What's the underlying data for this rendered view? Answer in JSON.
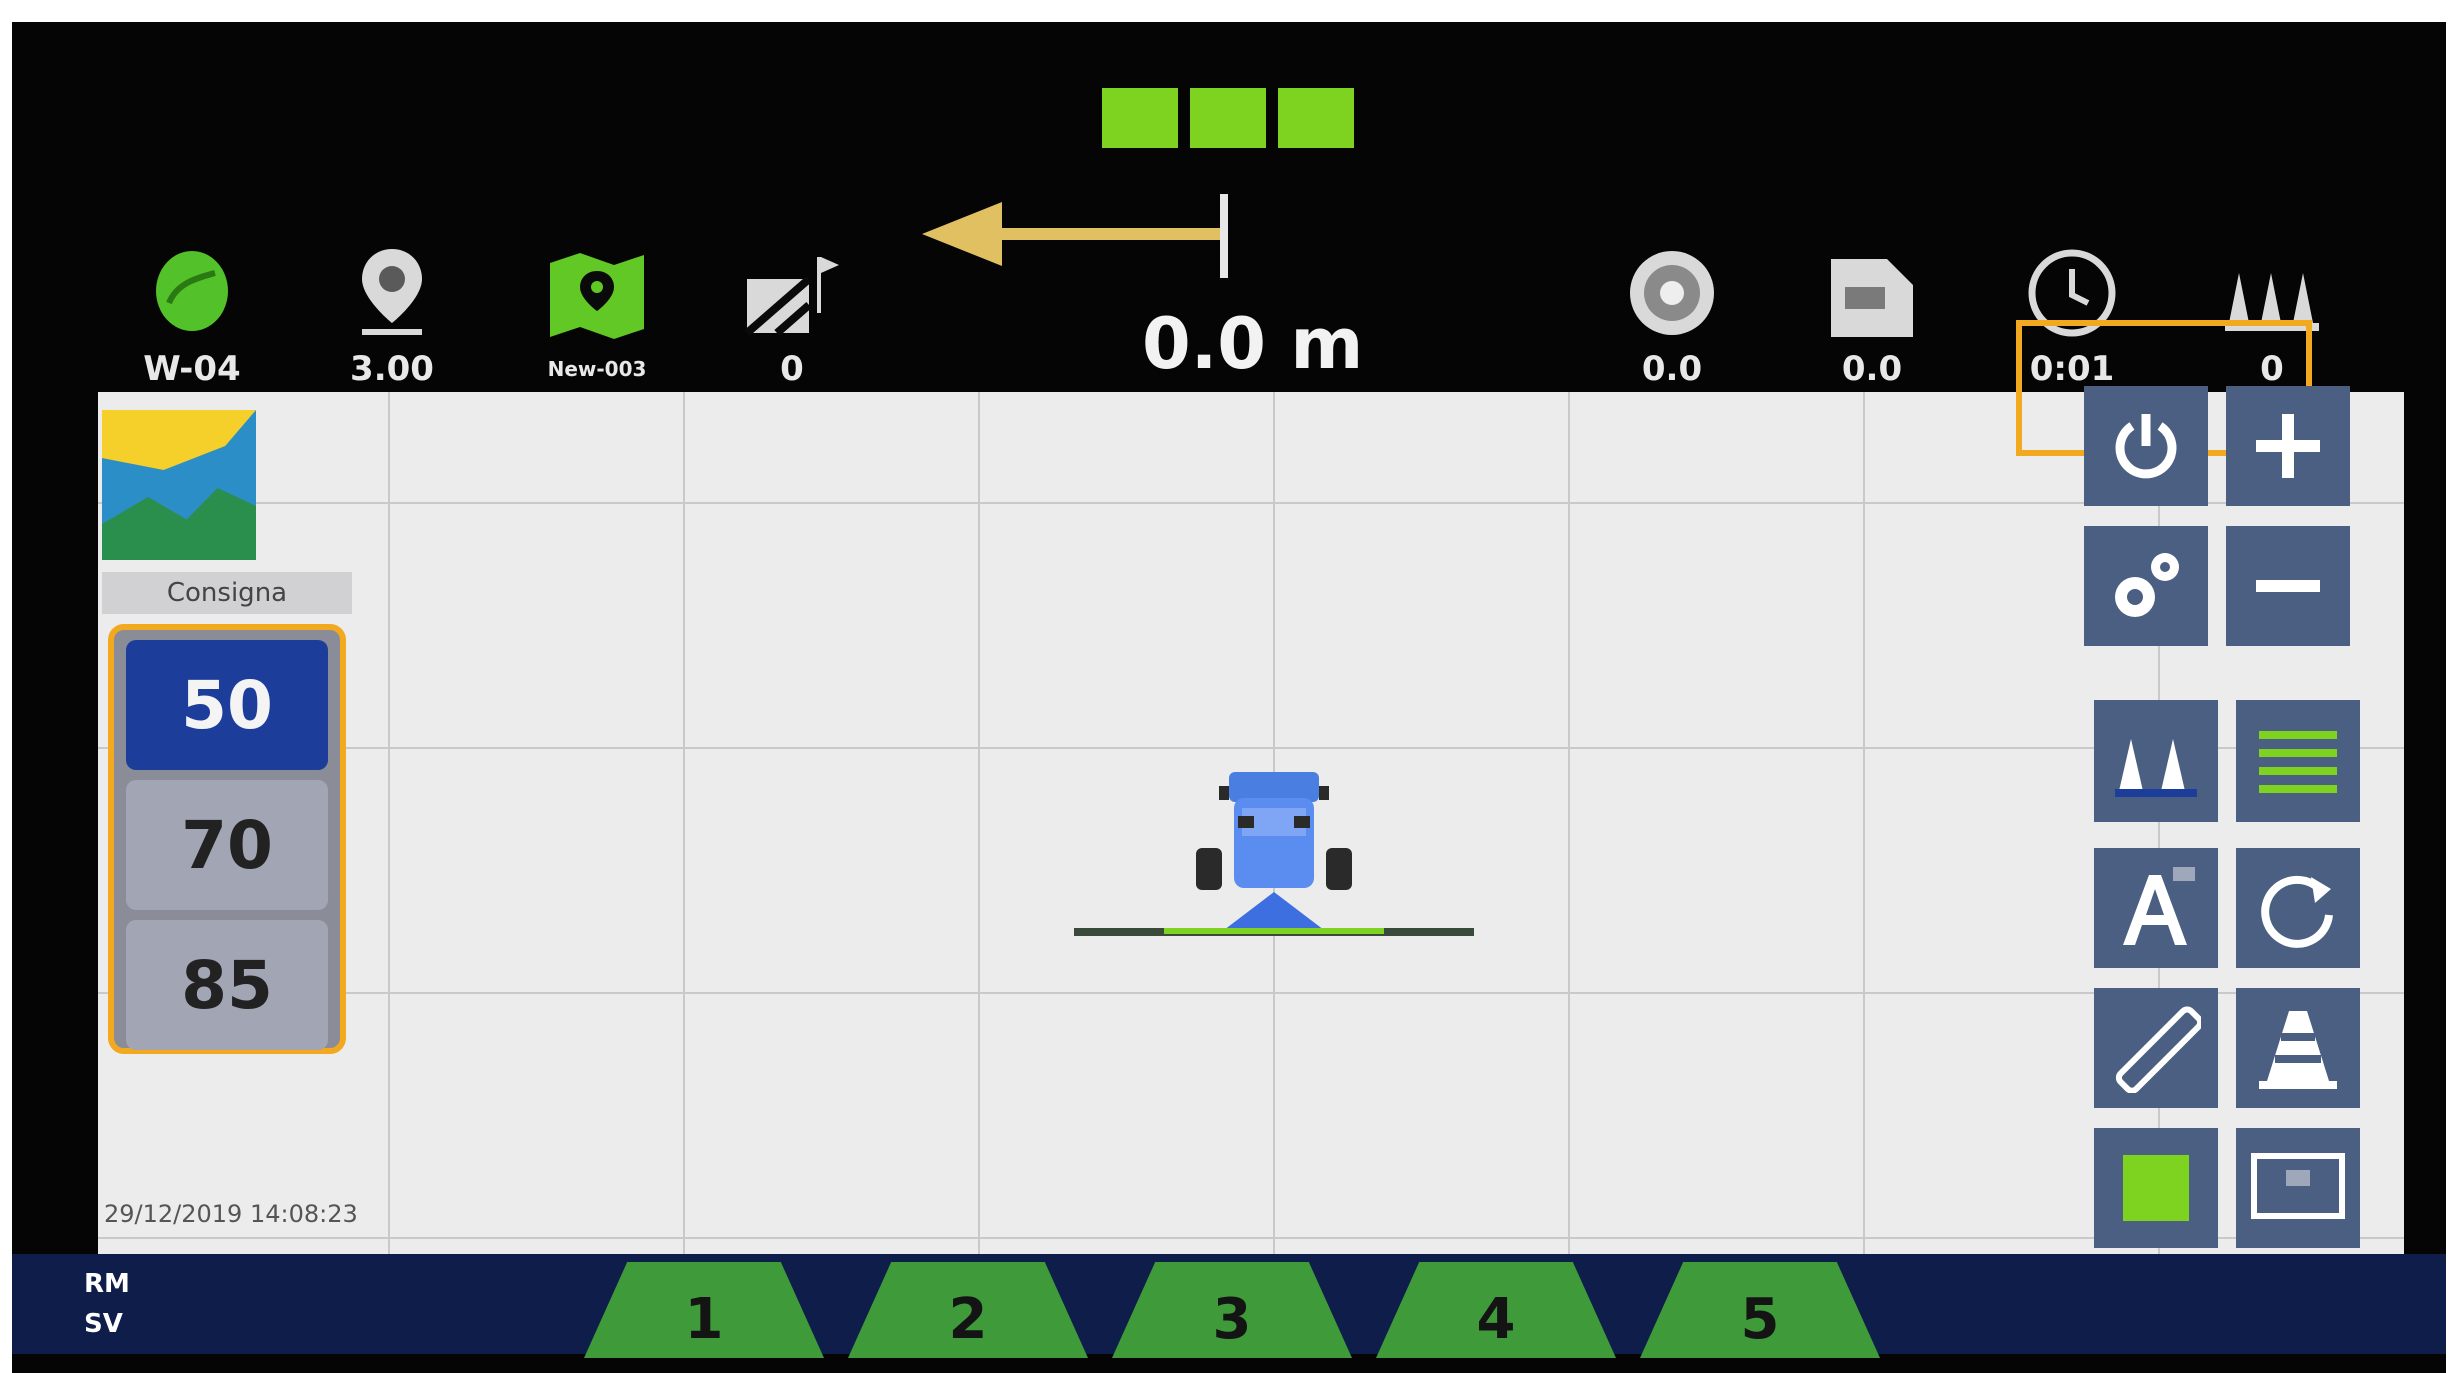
{
  "topbar": {
    "progress_blocks": 3,
    "stats_left": [
      {
        "name": "field-icon",
        "value": "W-04"
      },
      {
        "name": "location-pin-icon",
        "value": "3.00"
      },
      {
        "name": "field-map-icon",
        "value": "New-003"
      },
      {
        "name": "field-path-icon",
        "value": "0"
      }
    ],
    "distance": "0.0 m",
    "stats_right": [
      {
        "name": "speed-disc-icon",
        "value": "0.0"
      },
      {
        "name": "area-icon",
        "value": "0.0"
      },
      {
        "name": "clock-icon",
        "value": "0:01"
      },
      {
        "name": "rows-icon",
        "value": "0"
      }
    ]
  },
  "consigne": {
    "title": "Consigna",
    "items": [
      "50",
      "70",
      "85"
    ],
    "selected_index": 0
  },
  "map": {
    "timestamp": "29/12/2019 14:08:23"
  },
  "right_panel": {
    "buttons": [
      {
        "name": "power-button",
        "icon": "power-icon"
      },
      {
        "name": "zoom-in-button",
        "icon": "plus-icon"
      },
      {
        "name": "settings-button",
        "icon": "gears-icon"
      },
      {
        "name": "zoom-out-button",
        "icon": "minus-icon"
      },
      {
        "name": "row-mode-button",
        "icon": "rows-icon"
      },
      {
        "name": "guidance-lines-button",
        "icon": "lines-icon"
      },
      {
        "name": "auto-button",
        "icon": "auto-a-icon",
        "label": "A"
      },
      {
        "name": "reset-angle-button",
        "icon": "rotate-icon"
      },
      {
        "name": "measure-button",
        "icon": "ruler-icon"
      },
      {
        "name": "cone-button",
        "icon": "cone-icon"
      },
      {
        "name": "section-status-button",
        "icon": "green-square-icon"
      },
      {
        "name": "display-button",
        "icon": "screen-icon"
      }
    ]
  },
  "bottombar": {
    "mode_lines": [
      "RM",
      "SV"
    ],
    "sections": [
      "1",
      "2",
      "3",
      "4",
      "5"
    ]
  },
  "colors": {
    "accent_green": "#7ed321",
    "highlight_orange": "#f2a81f",
    "panel_blue": "#4a5f82",
    "selected_blue": "#1d3d9a",
    "section_green": "#3f9b3a",
    "bottom_navy": "#0e1d4a",
    "guide_arrow": "#e0c060"
  }
}
